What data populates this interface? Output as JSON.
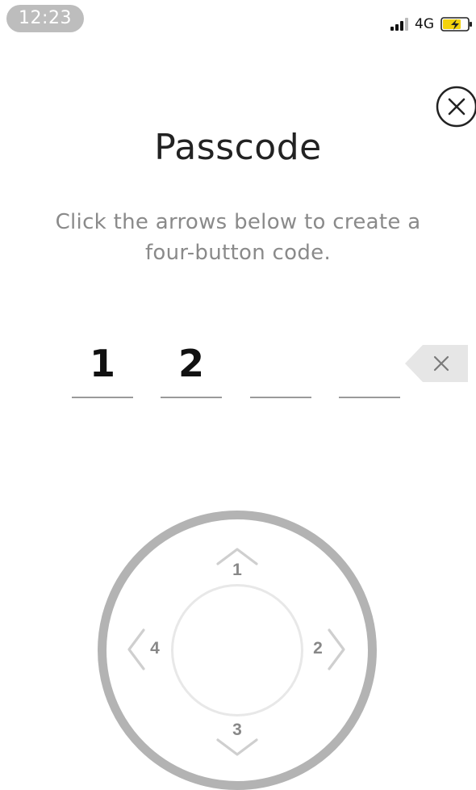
{
  "status_bar": {
    "time": "12:23",
    "network": "4G"
  },
  "screen": {
    "title": "Passcode",
    "instructions_line1": "Click the arrows below to create a",
    "instructions_line2": "four-button code."
  },
  "code": {
    "digits": [
      "1",
      "2",
      "",
      ""
    ]
  },
  "dial": {
    "up_label": "1",
    "right_label": "2",
    "down_label": "3",
    "left_label": "4"
  },
  "icons": {
    "close": "close-icon",
    "backspace": "backspace-icon",
    "signal": "signal-icon",
    "battery": "battery-charging-icon"
  },
  "colors": {
    "text_primary": "#222222",
    "text_secondary": "#8a8a8a",
    "time_pill": "#bdbdbd",
    "dial_ring": "#b3b3b3",
    "dial_inner": "#e8e8e8",
    "arrow": "#c8c8c8",
    "underline": "#9a9a9a",
    "backspace_bg": "#e6e6e6",
    "battery_charge": "#f3d20c"
  }
}
